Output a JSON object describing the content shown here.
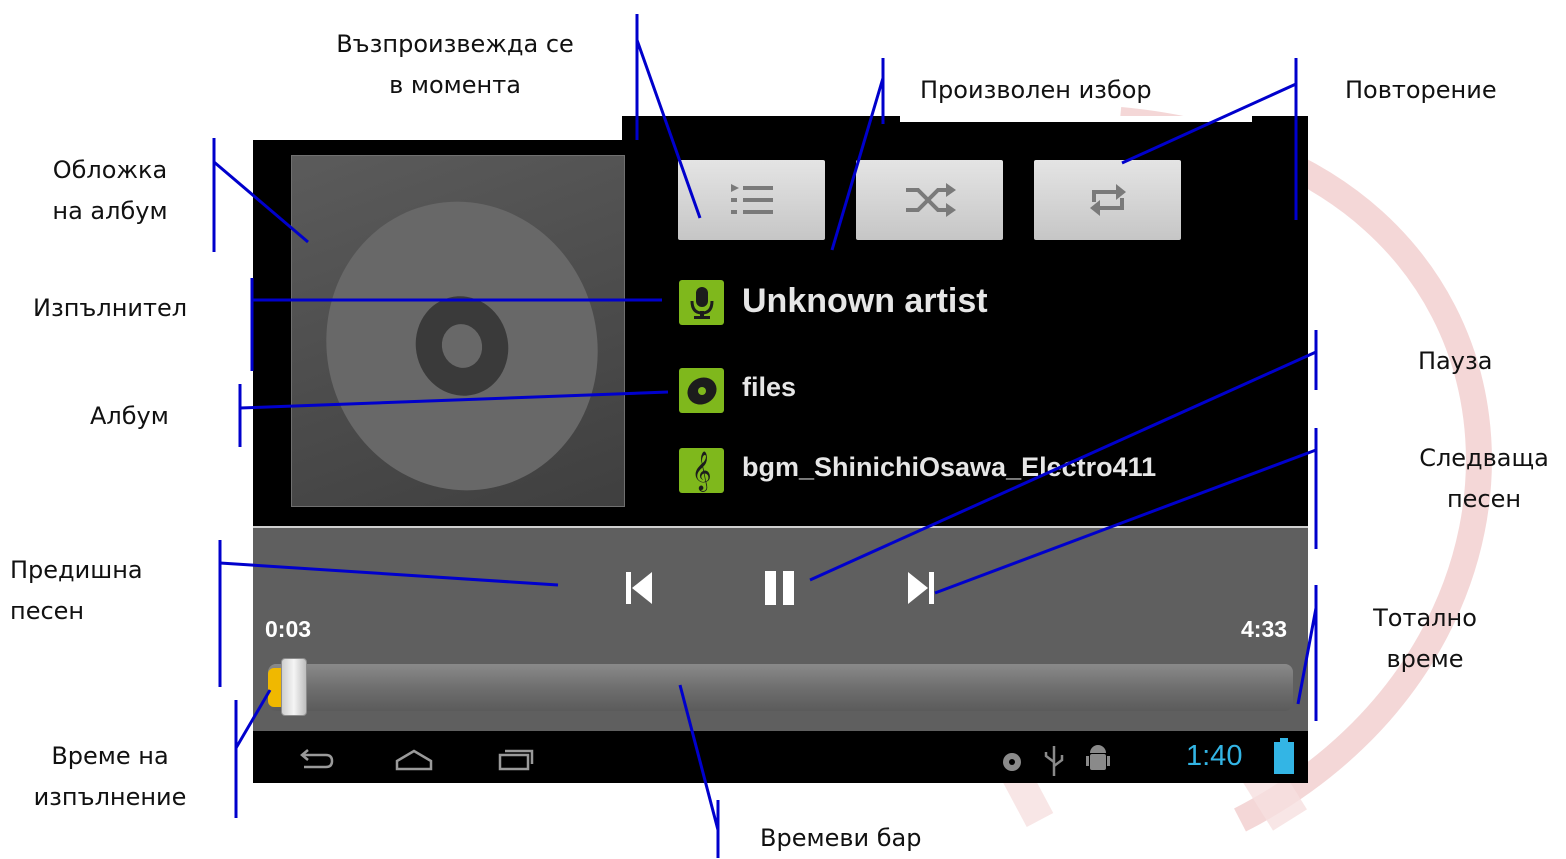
{
  "track": {
    "artist": "Unknown artist",
    "album": "files",
    "title": "bgm_ShinichiOsawa_Electro411"
  },
  "playback": {
    "elapsed": "0:03",
    "total": "4:33",
    "progress_fraction": 0.011
  },
  "status_bar": {
    "clock": "1:40"
  },
  "icons": {
    "now_playing": "list-icon",
    "shuffle": "shuffle-icon",
    "repeat": "repeat-icon",
    "artist": "microphone-icon",
    "album": "disc-icon",
    "song": "treble-clef-icon",
    "previous": "skip-previous-icon",
    "pause": "pause-icon",
    "next": "skip-next-icon",
    "nav_back": "back-icon",
    "nav_home": "home-icon",
    "nav_recent": "recent-apps-icon",
    "status": [
      "music-notification-icon",
      "usb-icon",
      "android-debug-icon",
      "battery-icon"
    ]
  },
  "colors": {
    "accent_green": "#7fb81c",
    "progress_orange": "#f0b800",
    "clock_blue": "#33b5e5",
    "callout_line": "#0000cc"
  },
  "annotations": {
    "now_playing_line1": "Възпроизвежда се",
    "now_playing_line2": "в момента",
    "shuffle": "Произволен избор",
    "repeat": "Повторение",
    "album_art_line1": "Обложка",
    "album_art_line2": "на албум",
    "artist": "Изпълнител",
    "album": "Албум",
    "pause": "Пауза",
    "next_line1": "Следваща",
    "next_line2": "песен",
    "previous_line1": "Предишна",
    "previous_line2": "песен",
    "total_line1": "Тотално",
    "total_line2": "време",
    "elapsed_line1": "Време на",
    "elapsed_line2": "изпълнение",
    "seekbar": "Времеви бар"
  }
}
